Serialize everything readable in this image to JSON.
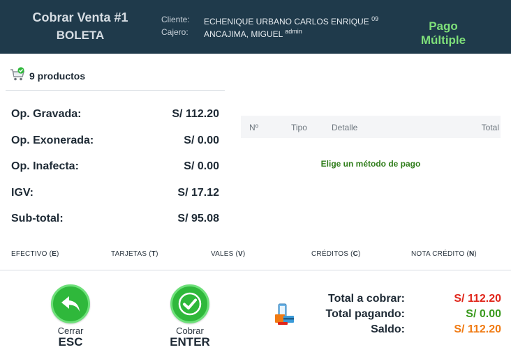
{
  "header": {
    "title": "Cobrar Venta #1",
    "doc_type": "BOLETA",
    "cliente_label": "Cliente:",
    "cliente_value": "ECHENIQUE URBANO CARLOS ENRIQUE",
    "cliente_sup": "09…",
    "cajero_label": "Cajero:",
    "cajero_value": "ANCAJIMA, MIGUEL",
    "cajero_sup": "admin",
    "mode": "Pago Múltiple",
    "colors": {
      "background": "#1f3a4b",
      "mode": "#7fe07a"
    }
  },
  "products": {
    "icon": "cart-check-icon",
    "label": "9 productos"
  },
  "summary": [
    {
      "label": "Op. Gravada:",
      "value": "S/ 112.20"
    },
    {
      "label": "Op. Exonerada:",
      "value": "S/ 0.00"
    },
    {
      "label": "Op. Inafecta:",
      "value": "S/ 0.00"
    },
    {
      "label": "IGV:",
      "value": "S/ 17.12"
    },
    {
      "label": "Sub-total:",
      "value": "S/ 95.08"
    }
  ],
  "payments_table": {
    "columns": [
      "Nº",
      "Tipo",
      "Detalle",
      "Total"
    ],
    "empty_message": "Elige un método de pago"
  },
  "methods": [
    {
      "label": "EFECTIVO",
      "key": "E"
    },
    {
      "label": "TARJETAS",
      "key": "T"
    },
    {
      "label": "VALES",
      "key": "V"
    },
    {
      "label": "CRÉDITOS",
      "key": "C"
    },
    {
      "label": "NOTA CRÉDITO",
      "key": "N"
    }
  ],
  "actions": {
    "cerrar": {
      "label": "Cerrar",
      "key": "ESC",
      "icon": "back-arrow-icon"
    },
    "cobrar": {
      "label": "Cobrar",
      "key": "ENTER",
      "icon": "checkmark-icon"
    }
  },
  "totals": {
    "total_cobrar_label": "Total a cobrar:",
    "total_cobrar_value": "S/ 112.20",
    "total_pagando_label": "Total pagando:",
    "total_pagando_value": "S/ 0.00",
    "saldo_label": "Saldo:",
    "saldo_value": "S/ 112.20",
    "colors": {
      "cobrar": "#e0261b",
      "pagando": "#3a9a1e",
      "saldo": "#f07a12"
    }
  }
}
